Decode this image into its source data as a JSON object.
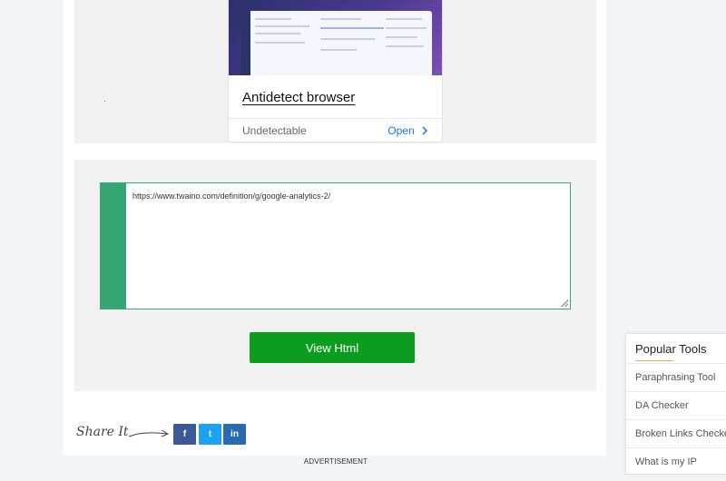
{
  "ad": {
    "dot": ".",
    "title": "Antidetect browser",
    "subtitle": "Undetectable",
    "cta": "Open",
    "cta_icon": "chevron-right-icon"
  },
  "tool": {
    "url_value": "https://www.twaino.com/definition/g/google-analytics-2/",
    "button_label": "View Html"
  },
  "share": {
    "label": "Share It",
    "facebook": "f",
    "twitter": "t",
    "linkedin": "in"
  },
  "advertisement_label": "ADVERTISEMENT",
  "popular_tools": {
    "title": "Popular Tools",
    "items": [
      "Paraphrasing Tool",
      "DA Checker",
      "Broken Links Checker",
      "What is my IP"
    ]
  },
  "colors": {
    "accent_green": "#0c9d1f",
    "gutter_green": "#36a673",
    "link_blue": "#1a73e8"
  }
}
